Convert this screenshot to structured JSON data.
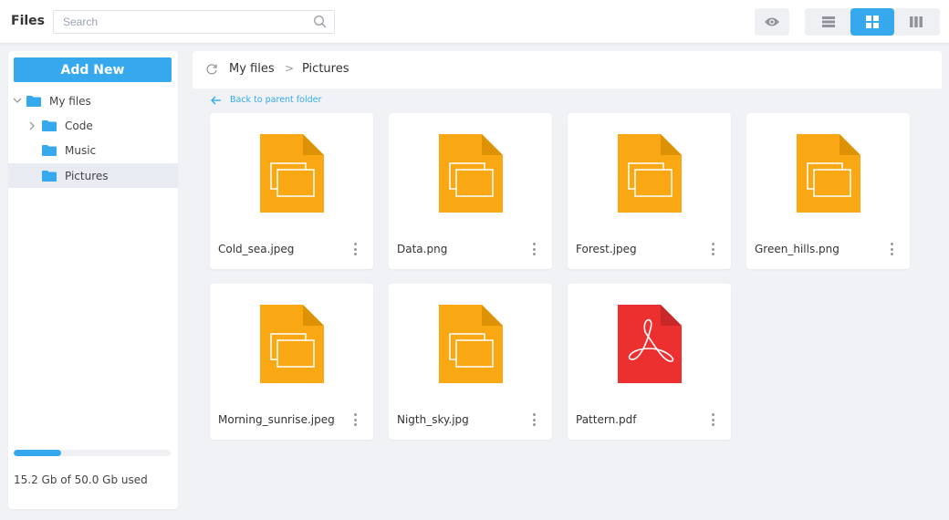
{
  "header": {
    "title": "Files",
    "search_placeholder": "Search",
    "search_value": "",
    "icons": {
      "search": "search-icon",
      "preview": "eye-icon"
    },
    "view_modes": [
      {
        "name": "list",
        "icon": "list-view-icon",
        "active": false
      },
      {
        "name": "grid",
        "icon": "grid-view-icon",
        "active": true
      },
      {
        "name": "columns",
        "icon": "columns-view-icon",
        "active": false
      }
    ],
    "accent_color": "#36a9ee"
  },
  "sidebar": {
    "add_new_label": "Add New",
    "tree": [
      {
        "label": "My files",
        "level": 0,
        "expanded": true,
        "has_children": true,
        "selected": false
      },
      {
        "label": "Code",
        "level": 1,
        "expanded": false,
        "has_children": true,
        "selected": false
      },
      {
        "label": "Music",
        "level": 1,
        "expanded": false,
        "has_children": false,
        "selected": false
      },
      {
        "label": "Pictures",
        "level": 1,
        "expanded": false,
        "has_children": false,
        "selected": true
      }
    ],
    "storage": {
      "used": "15.2",
      "total": "50.0",
      "unit": "Gb",
      "fraction_used": 0.304,
      "text": "15.2 Gb of 50.0 Gb used"
    }
  },
  "breadcrumb": {
    "items": [
      "My files",
      "Pictures"
    ],
    "separator": ">",
    "back_label": "Back to parent folder"
  },
  "files": [
    {
      "name": "Cold_sea.jpeg",
      "type": "image",
      "color": "#f9a814"
    },
    {
      "name": "Data.png",
      "type": "image",
      "color": "#f9a814"
    },
    {
      "name": "Forest.jpeg",
      "type": "image",
      "color": "#f9a814"
    },
    {
      "name": "Green_hills.png",
      "type": "image",
      "color": "#f9a814"
    },
    {
      "name": "Morning_sunrise.jpeg",
      "type": "image",
      "color": "#f9a814"
    },
    {
      "name": "Nigth_sky.jpg",
      "type": "image",
      "color": "#f9a814"
    },
    {
      "name": "Pattern.pdf",
      "type": "pdf",
      "color": "#ec2f2f"
    }
  ]
}
